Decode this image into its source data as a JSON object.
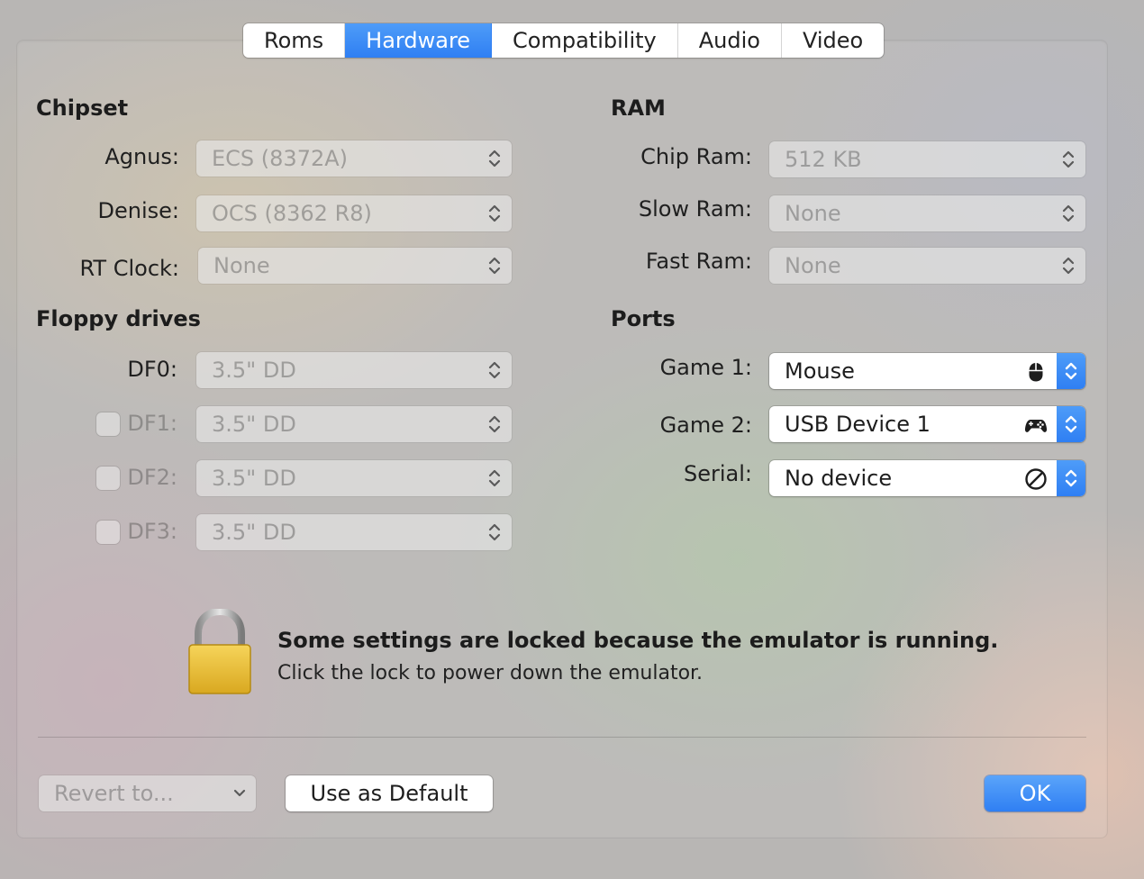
{
  "tabs": [
    {
      "label": "Roms",
      "active": false
    },
    {
      "label": "Hardware",
      "active": true
    },
    {
      "label": "Compatibility",
      "active": false
    },
    {
      "label": "Audio",
      "active": false
    },
    {
      "label": "Video",
      "active": false
    }
  ],
  "chipset": {
    "heading": "Chipset",
    "agnus": {
      "label": "Agnus:",
      "value": "ECS (8372A)"
    },
    "denise": {
      "label": "Denise:",
      "value": "OCS (8362 R8)"
    },
    "rtclock": {
      "label": "RT Clock:",
      "value": "None"
    }
  },
  "ram": {
    "heading": "RAM",
    "chip": {
      "label": "Chip Ram:",
      "value": "512 KB"
    },
    "slow": {
      "label": "Slow Ram:",
      "value": "None"
    },
    "fast": {
      "label": "Fast Ram:",
      "value": "None"
    }
  },
  "floppy": {
    "heading": "Floppy drives",
    "df0": {
      "label": "DF0:",
      "value": "3.5\" DD"
    },
    "df1": {
      "label": "DF1:",
      "value": "3.5\" DD",
      "checked": false
    },
    "df2": {
      "label": "DF2:",
      "value": "3.5\" DD",
      "checked": false
    },
    "df3": {
      "label": "DF3:",
      "value": "3.5\" DD",
      "checked": false
    }
  },
  "ports": {
    "heading": "Ports",
    "game1": {
      "label": "Game 1:",
      "value": "Mouse",
      "icon": "mouse-icon"
    },
    "game2": {
      "label": "Game 2:",
      "value": "USB Device 1",
      "icon": "gamepad-icon"
    },
    "serial": {
      "label": "Serial:",
      "value": "No device",
      "icon": "no-device-icon"
    }
  },
  "lock_message": {
    "title": "Some settings are locked because the emulator is running.",
    "subtitle": "Click the lock to power down the emulator."
  },
  "footer": {
    "revert_label": "Revert to...",
    "default_label": "Use as Default",
    "ok_label": "OK"
  },
  "colors": {
    "accent": "#2f7ff3",
    "lock_body": "#f2c94c"
  }
}
